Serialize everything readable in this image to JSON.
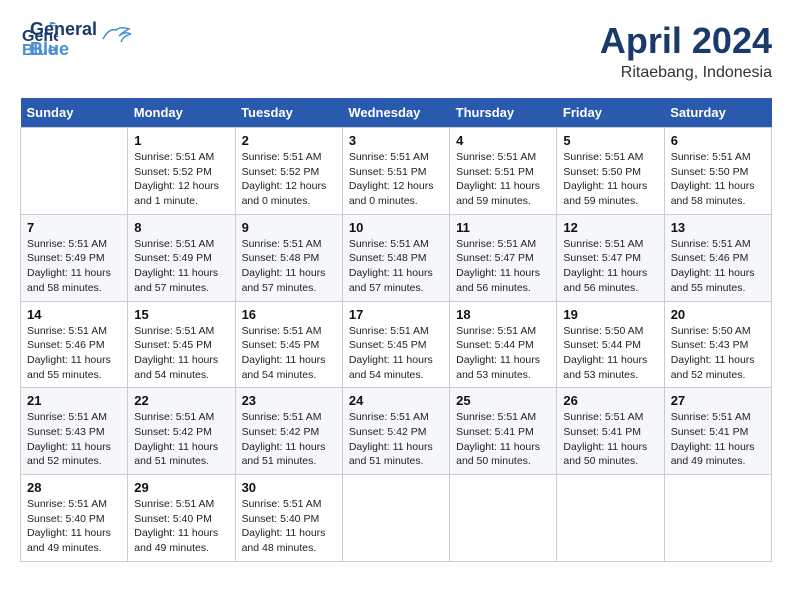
{
  "header": {
    "logo_general": "General",
    "logo_blue": "Blue",
    "month_title": "April 2024",
    "location": "Ritaebang, Indonesia"
  },
  "weekdays": [
    "Sunday",
    "Monday",
    "Tuesday",
    "Wednesday",
    "Thursday",
    "Friday",
    "Saturday"
  ],
  "weeks": [
    [
      {
        "day": "",
        "sunrise": "",
        "sunset": "",
        "daylight": ""
      },
      {
        "day": "1",
        "sunrise": "Sunrise: 5:51 AM",
        "sunset": "Sunset: 5:52 PM",
        "daylight": "Daylight: 12 hours and 1 minute."
      },
      {
        "day": "2",
        "sunrise": "Sunrise: 5:51 AM",
        "sunset": "Sunset: 5:52 PM",
        "daylight": "Daylight: 12 hours and 0 minutes."
      },
      {
        "day": "3",
        "sunrise": "Sunrise: 5:51 AM",
        "sunset": "Sunset: 5:51 PM",
        "daylight": "Daylight: 12 hours and 0 minutes."
      },
      {
        "day": "4",
        "sunrise": "Sunrise: 5:51 AM",
        "sunset": "Sunset: 5:51 PM",
        "daylight": "Daylight: 11 hours and 59 minutes."
      },
      {
        "day": "5",
        "sunrise": "Sunrise: 5:51 AM",
        "sunset": "Sunset: 5:50 PM",
        "daylight": "Daylight: 11 hours and 59 minutes."
      },
      {
        "day": "6",
        "sunrise": "Sunrise: 5:51 AM",
        "sunset": "Sunset: 5:50 PM",
        "daylight": "Daylight: 11 hours and 58 minutes."
      }
    ],
    [
      {
        "day": "7",
        "sunrise": "Sunrise: 5:51 AM",
        "sunset": "Sunset: 5:49 PM",
        "daylight": "Daylight: 11 hours and 58 minutes."
      },
      {
        "day": "8",
        "sunrise": "Sunrise: 5:51 AM",
        "sunset": "Sunset: 5:49 PM",
        "daylight": "Daylight: 11 hours and 57 minutes."
      },
      {
        "day": "9",
        "sunrise": "Sunrise: 5:51 AM",
        "sunset": "Sunset: 5:48 PM",
        "daylight": "Daylight: 11 hours and 57 minutes."
      },
      {
        "day": "10",
        "sunrise": "Sunrise: 5:51 AM",
        "sunset": "Sunset: 5:48 PM",
        "daylight": "Daylight: 11 hours and 57 minutes."
      },
      {
        "day": "11",
        "sunrise": "Sunrise: 5:51 AM",
        "sunset": "Sunset: 5:47 PM",
        "daylight": "Daylight: 11 hours and 56 minutes."
      },
      {
        "day": "12",
        "sunrise": "Sunrise: 5:51 AM",
        "sunset": "Sunset: 5:47 PM",
        "daylight": "Daylight: 11 hours and 56 minutes."
      },
      {
        "day": "13",
        "sunrise": "Sunrise: 5:51 AM",
        "sunset": "Sunset: 5:46 PM",
        "daylight": "Daylight: 11 hours and 55 minutes."
      }
    ],
    [
      {
        "day": "14",
        "sunrise": "Sunrise: 5:51 AM",
        "sunset": "Sunset: 5:46 PM",
        "daylight": "Daylight: 11 hours and 55 minutes."
      },
      {
        "day": "15",
        "sunrise": "Sunrise: 5:51 AM",
        "sunset": "Sunset: 5:45 PM",
        "daylight": "Daylight: 11 hours and 54 minutes."
      },
      {
        "day": "16",
        "sunrise": "Sunrise: 5:51 AM",
        "sunset": "Sunset: 5:45 PM",
        "daylight": "Daylight: 11 hours and 54 minutes."
      },
      {
        "day": "17",
        "sunrise": "Sunrise: 5:51 AM",
        "sunset": "Sunset: 5:45 PM",
        "daylight": "Daylight: 11 hours and 54 minutes."
      },
      {
        "day": "18",
        "sunrise": "Sunrise: 5:51 AM",
        "sunset": "Sunset: 5:44 PM",
        "daylight": "Daylight: 11 hours and 53 minutes."
      },
      {
        "day": "19",
        "sunrise": "Sunrise: 5:50 AM",
        "sunset": "Sunset: 5:44 PM",
        "daylight": "Daylight: 11 hours and 53 minutes."
      },
      {
        "day": "20",
        "sunrise": "Sunrise: 5:50 AM",
        "sunset": "Sunset: 5:43 PM",
        "daylight": "Daylight: 11 hours and 52 minutes."
      }
    ],
    [
      {
        "day": "21",
        "sunrise": "Sunrise: 5:51 AM",
        "sunset": "Sunset: 5:43 PM",
        "daylight": "Daylight: 11 hours and 52 minutes."
      },
      {
        "day": "22",
        "sunrise": "Sunrise: 5:51 AM",
        "sunset": "Sunset: 5:42 PM",
        "daylight": "Daylight: 11 hours and 51 minutes."
      },
      {
        "day": "23",
        "sunrise": "Sunrise: 5:51 AM",
        "sunset": "Sunset: 5:42 PM",
        "daylight": "Daylight: 11 hours and 51 minutes."
      },
      {
        "day": "24",
        "sunrise": "Sunrise: 5:51 AM",
        "sunset": "Sunset: 5:42 PM",
        "daylight": "Daylight: 11 hours and 51 minutes."
      },
      {
        "day": "25",
        "sunrise": "Sunrise: 5:51 AM",
        "sunset": "Sunset: 5:41 PM",
        "daylight": "Daylight: 11 hours and 50 minutes."
      },
      {
        "day": "26",
        "sunrise": "Sunrise: 5:51 AM",
        "sunset": "Sunset: 5:41 PM",
        "daylight": "Daylight: 11 hours and 50 minutes."
      },
      {
        "day": "27",
        "sunrise": "Sunrise: 5:51 AM",
        "sunset": "Sunset: 5:41 PM",
        "daylight": "Daylight: 11 hours and 49 minutes."
      }
    ],
    [
      {
        "day": "28",
        "sunrise": "Sunrise: 5:51 AM",
        "sunset": "Sunset: 5:40 PM",
        "daylight": "Daylight: 11 hours and 49 minutes."
      },
      {
        "day": "29",
        "sunrise": "Sunrise: 5:51 AM",
        "sunset": "Sunset: 5:40 PM",
        "daylight": "Daylight: 11 hours and 49 minutes."
      },
      {
        "day": "30",
        "sunrise": "Sunrise: 5:51 AM",
        "sunset": "Sunset: 5:40 PM",
        "daylight": "Daylight: 11 hours and 48 minutes."
      },
      {
        "day": "",
        "sunrise": "",
        "sunset": "",
        "daylight": ""
      },
      {
        "day": "",
        "sunrise": "",
        "sunset": "",
        "daylight": ""
      },
      {
        "day": "",
        "sunrise": "",
        "sunset": "",
        "daylight": ""
      },
      {
        "day": "",
        "sunrise": "",
        "sunset": "",
        "daylight": ""
      }
    ]
  ]
}
